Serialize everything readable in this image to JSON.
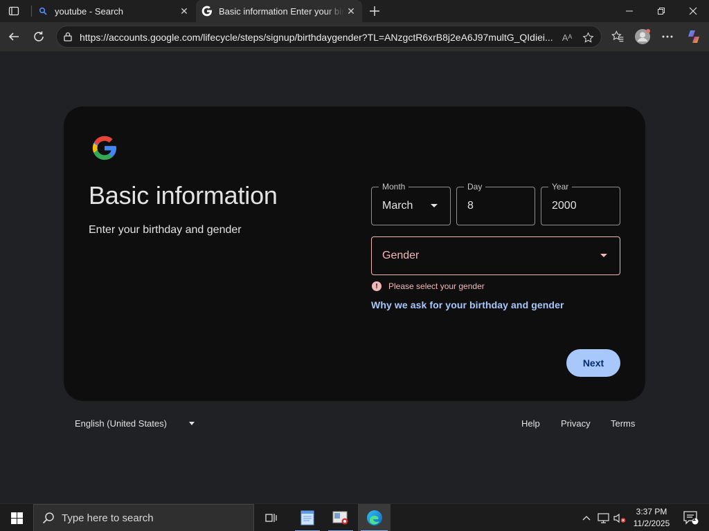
{
  "browser": {
    "tabs": [
      {
        "title": "youtube - Search",
        "active": false,
        "icon": "search-favicon"
      },
      {
        "title": "Basic information Enter your birthday and gender",
        "active": true,
        "icon": "google-favicon"
      }
    ],
    "url": "https://accounts.google.com/lifecycle/steps/signup/birthdaygender?TL=ANzgctR6xrB8j2eA6J97multG_QIdiei...",
    "read_aloud_label": "Aᴬ"
  },
  "page": {
    "title": "Basic information",
    "subtitle": "Enter your birthday and gender",
    "month": {
      "label": "Month",
      "value": "March"
    },
    "day": {
      "label": "Day",
      "value": "8"
    },
    "year": {
      "label": "Year",
      "value": "2000"
    },
    "gender": {
      "placeholder": "Gender"
    },
    "error": "Please select your gender",
    "why_link": "Why we ask for your birthday and gender",
    "next_label": "Next"
  },
  "footer": {
    "language": "English (United States)",
    "help": "Help",
    "privacy": "Privacy",
    "terms": "Terms"
  },
  "taskbar": {
    "search_placeholder": "Type here to search",
    "time": "3:37 PM",
    "date": "11/2/2025",
    "notification_count": "1"
  },
  "colors": {
    "accent": "#a8c7fa",
    "error": "#f2b8b5",
    "card_bg": "#0e0e0e",
    "page_bg": "#202124"
  }
}
